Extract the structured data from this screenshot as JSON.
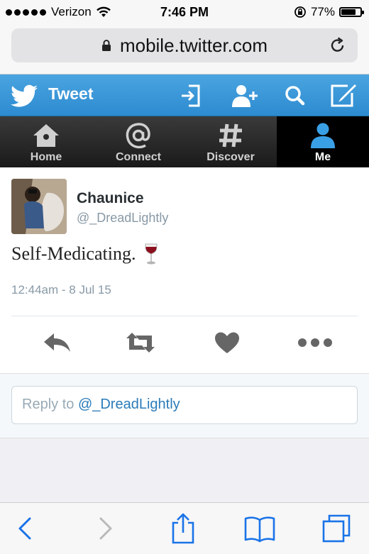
{
  "status_bar": {
    "carrier": "Verizon",
    "time": "7:46 PM",
    "battery": "77%",
    "battery_level": 0.77,
    "signal_bars": 5,
    "icons": [
      "wifi-icon",
      "orientation-lock-icon",
      "battery-icon"
    ]
  },
  "address_bar": {
    "url": "mobile.twitter.com",
    "icons": [
      "lock-icon",
      "reload-icon"
    ]
  },
  "twitter_header": {
    "title": "Tweet",
    "icons": [
      "twitter-bird-icon",
      "sign-in-icon",
      "add-user-icon",
      "search-icon",
      "compose-icon"
    ]
  },
  "nav": {
    "items": [
      {
        "label": "Home",
        "icon": "home-icon"
      },
      {
        "label": "Connect",
        "icon": "at-icon"
      },
      {
        "label": "Discover",
        "icon": "hash-icon"
      },
      {
        "label": "Me",
        "icon": "person-icon",
        "active": true
      }
    ]
  },
  "tweet": {
    "author_name": "Chaunice",
    "author_handle": "@_DreadLightly",
    "text": "Self-Medicating.",
    "emoji": "wine-glass-icon",
    "timestamp": "12:44am - 8 Jul 15",
    "actions": [
      "reply-icon",
      "retweet-icon",
      "heart-icon",
      "more-icon"
    ]
  },
  "reply": {
    "prefix": "Reply to ",
    "mention": "@_DreadLightly"
  },
  "safari_toolbar": {
    "icons": [
      "back-icon",
      "forward-icon",
      "share-icon",
      "bookmarks-icon",
      "tabs-icon"
    ]
  },
  "colors": {
    "twitter_blue": "#3a97d8",
    "link_blue": "#2b7bb9",
    "ios_blue": "#1a73e8",
    "wine": "#8b0f1d"
  }
}
